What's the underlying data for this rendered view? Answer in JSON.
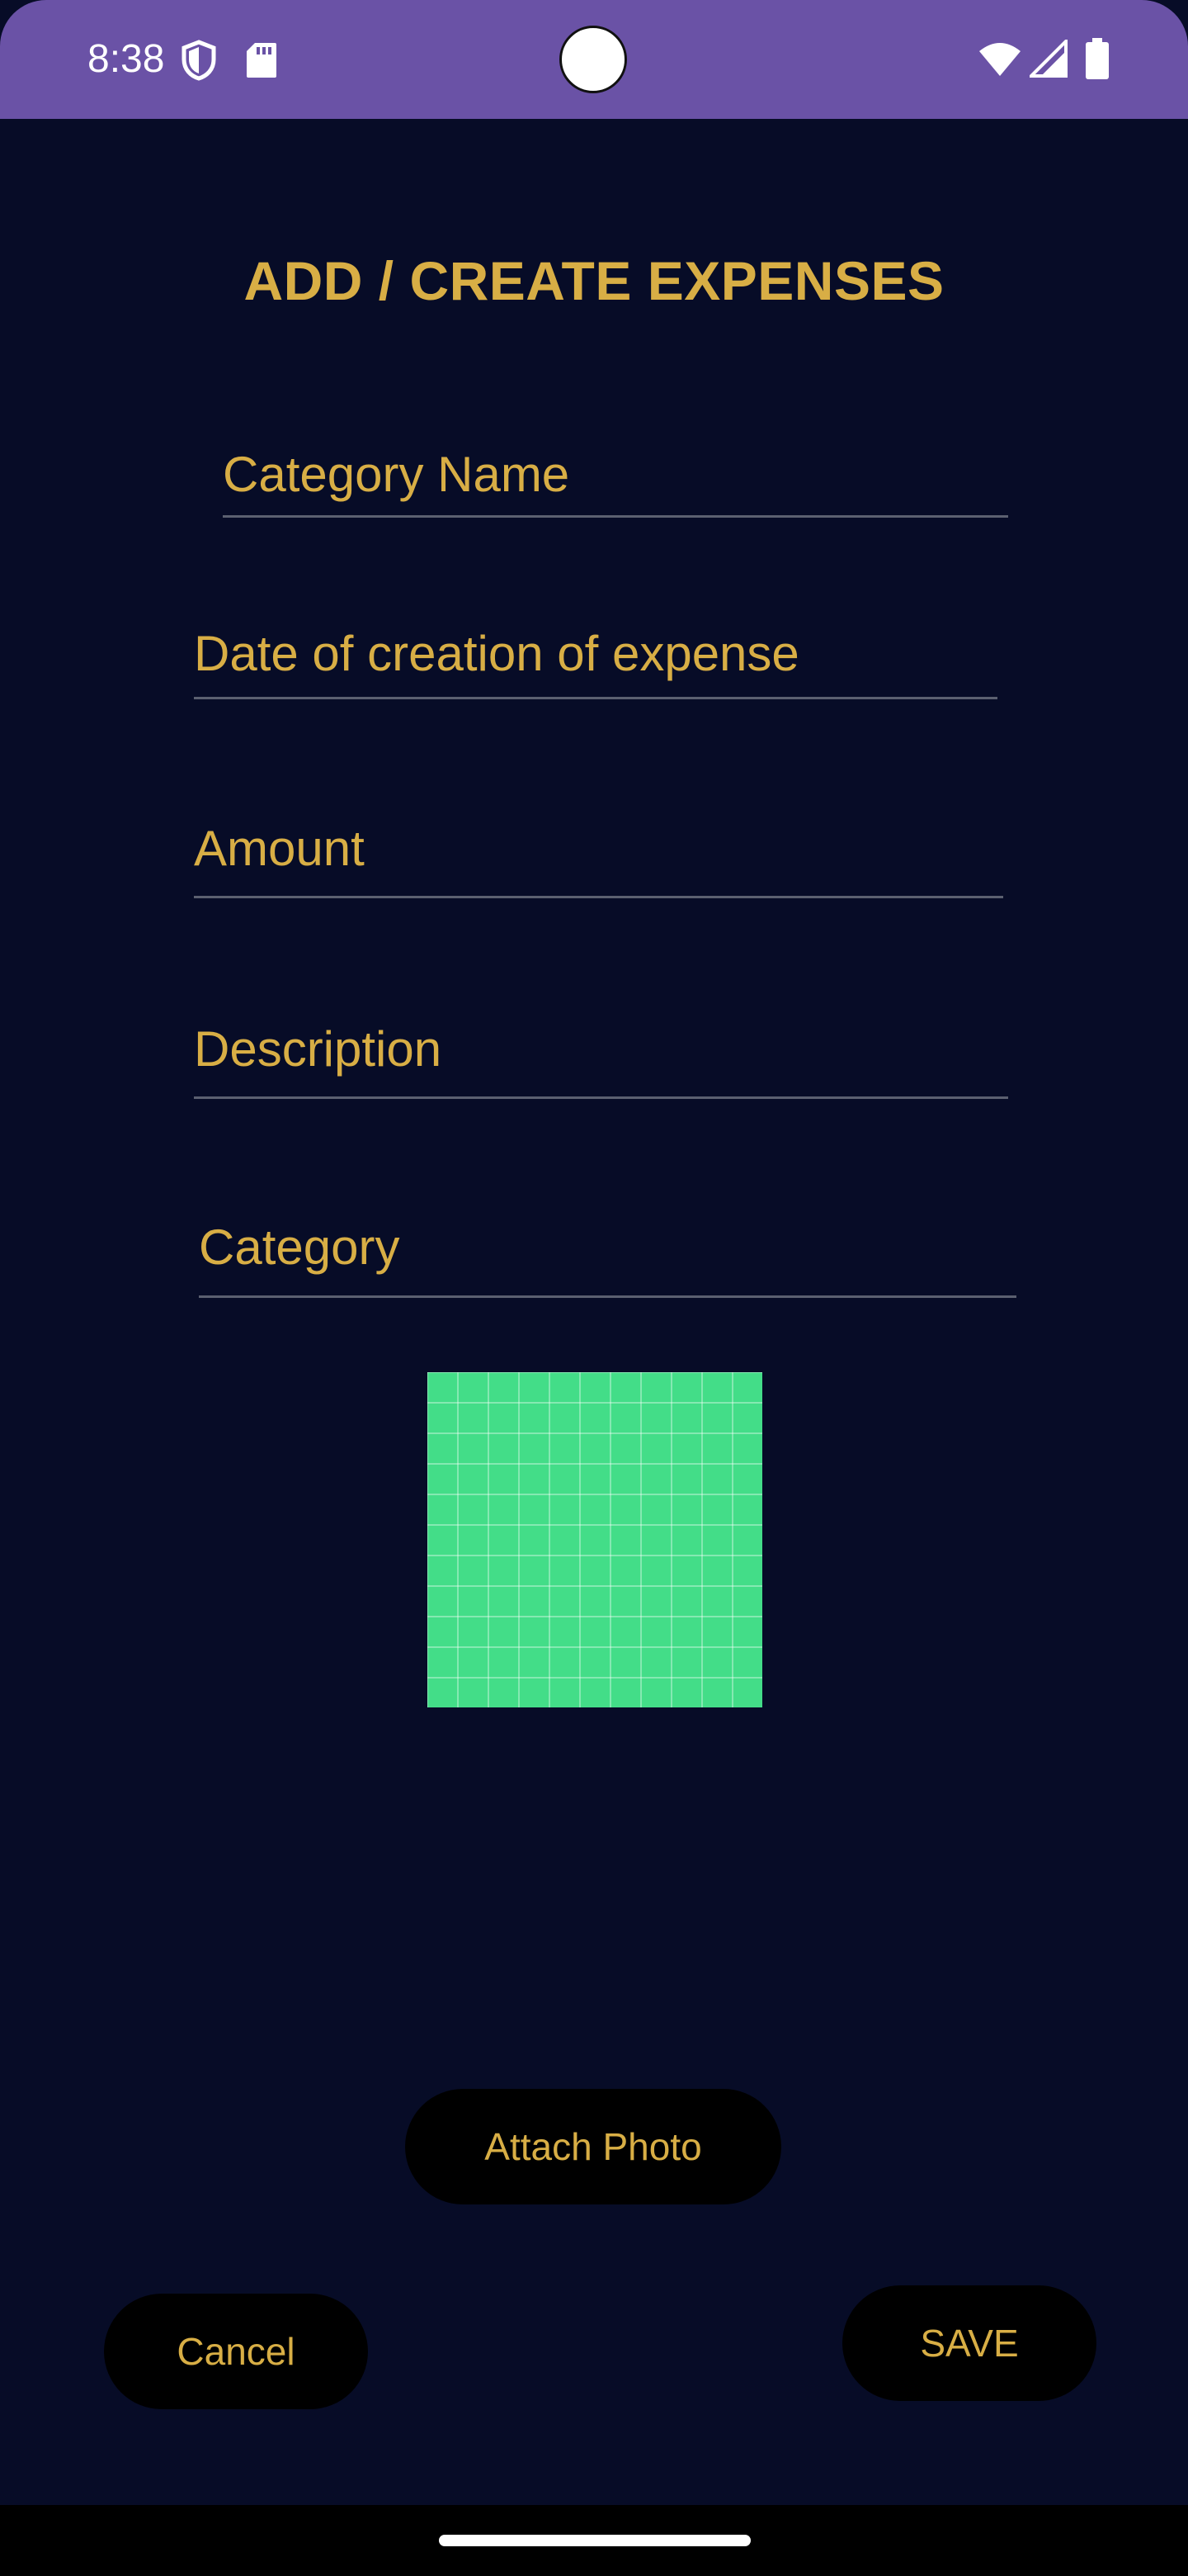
{
  "status_bar": {
    "time": "8:38",
    "icons": [
      "shield-icon",
      "sd-card-icon",
      "wifi-icon",
      "signal-icon",
      "battery-icon"
    ],
    "background_color": "#6a52a6"
  },
  "page": {
    "title": "ADD / CREATE EXPENSES",
    "background_color": "#070c27",
    "accent_color": "#d8ae45"
  },
  "form": {
    "category_name": {
      "placeholder": "Category Name",
      "value": ""
    },
    "date": {
      "placeholder": "Date of creation of expense",
      "value": ""
    },
    "amount": {
      "placeholder": "Amount",
      "value": ""
    },
    "description": {
      "placeholder": "Description",
      "value": ""
    },
    "category": {
      "placeholder": "Category",
      "value": ""
    }
  },
  "photo": {
    "icon": "image-placeholder-icon",
    "color": "#43dd88"
  },
  "buttons": {
    "attach_photo": "Attach Photo",
    "cancel": "Cancel",
    "save": "SAVE"
  }
}
